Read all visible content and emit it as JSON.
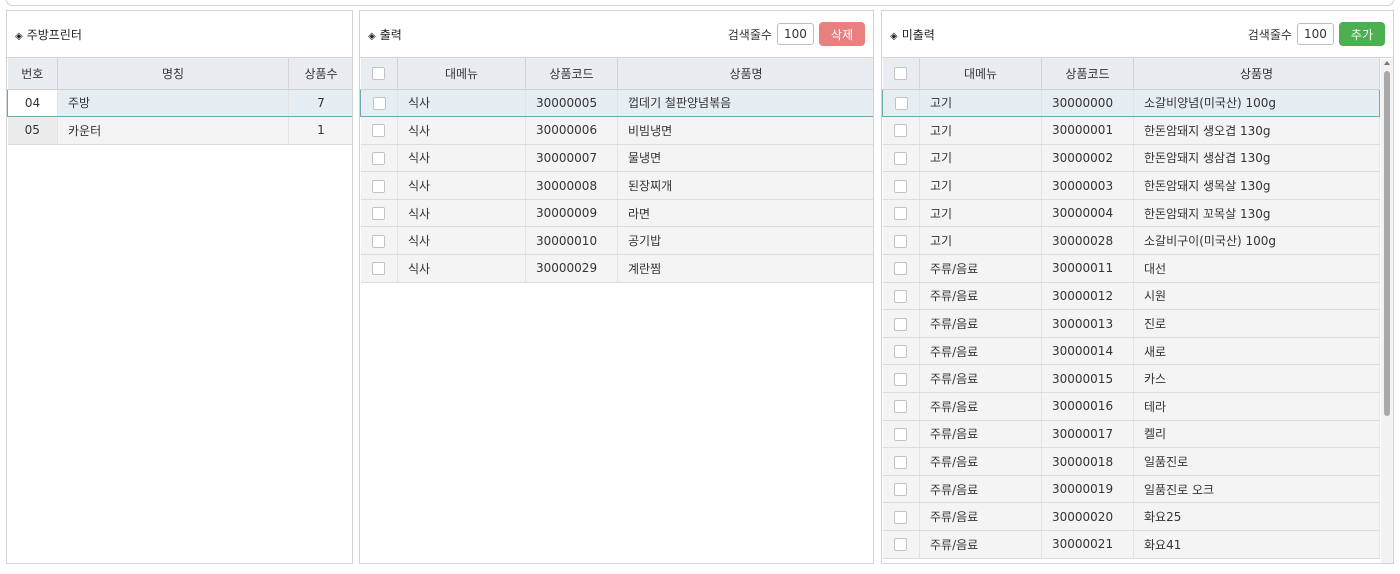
{
  "kitchen": {
    "title": "주방프린터",
    "columns": [
      "번호",
      "명칭",
      "상품수"
    ],
    "rows": [
      {
        "no": "04",
        "name": "주방",
        "count": "7"
      },
      {
        "no": "05",
        "name": "카운터",
        "count": "1"
      }
    ]
  },
  "printed": {
    "title": "출력",
    "search_label": "검색줄수",
    "search_value": "100",
    "action_label": "삭제",
    "columns": [
      "대메뉴",
      "상품코드",
      "상품명"
    ],
    "rows": [
      {
        "menu": "식사",
        "code": "30000005",
        "name": "껍데기 철판양념볶음"
      },
      {
        "menu": "식사",
        "code": "30000006",
        "name": "비빔냉면"
      },
      {
        "menu": "식사",
        "code": "30000007",
        "name": "물냉면"
      },
      {
        "menu": "식사",
        "code": "30000008",
        "name": "된장찌개"
      },
      {
        "menu": "식사",
        "code": "30000009",
        "name": "라면"
      },
      {
        "menu": "식사",
        "code": "30000010",
        "name": "공기밥"
      },
      {
        "menu": "식사",
        "code": "30000029",
        "name": "계란찜"
      }
    ]
  },
  "unprinted": {
    "title": "미출력",
    "search_label": "검색줄수",
    "search_value": "100",
    "action_label": "추가",
    "columns": [
      "대메뉴",
      "상품코드",
      "상품명"
    ],
    "rows": [
      {
        "menu": "고기",
        "code": "30000000",
        "name": "소갈비양념(미국산) 100g"
      },
      {
        "menu": "고기",
        "code": "30000001",
        "name": "한돈암돼지 생오겹 130g"
      },
      {
        "menu": "고기",
        "code": "30000002",
        "name": "한돈암돼지 생삼겹 130g"
      },
      {
        "menu": "고기",
        "code": "30000003",
        "name": "한돈암돼지 생목살 130g"
      },
      {
        "menu": "고기",
        "code": "30000004",
        "name": "한돈암돼지 꼬목살 130g"
      },
      {
        "menu": "고기",
        "code": "30000028",
        "name": "소갈비구이(미국산) 100g"
      },
      {
        "menu": "주류/음료",
        "code": "30000011",
        "name": "대선"
      },
      {
        "menu": "주류/음료",
        "code": "30000012",
        "name": "시원"
      },
      {
        "menu": "주류/음료",
        "code": "30000013",
        "name": "진로"
      },
      {
        "menu": "주류/음료",
        "code": "30000014",
        "name": "새로"
      },
      {
        "menu": "주류/음료",
        "code": "30000015",
        "name": "카스"
      },
      {
        "menu": "주류/음료",
        "code": "30000016",
        "name": "테라"
      },
      {
        "menu": "주류/음료",
        "code": "30000017",
        "name": "켈리"
      },
      {
        "menu": "주류/음료",
        "code": "30000018",
        "name": "일품진로"
      },
      {
        "menu": "주류/음료",
        "code": "30000019",
        "name": "일품진로 오크"
      },
      {
        "menu": "주류/음료",
        "code": "30000020",
        "name": "화요25"
      },
      {
        "menu": "주류/음료",
        "code": "30000021",
        "name": "화요41"
      }
    ]
  },
  "icons": {
    "section": "diamond-icon",
    "checkbox": "checkbox-icon"
  }
}
